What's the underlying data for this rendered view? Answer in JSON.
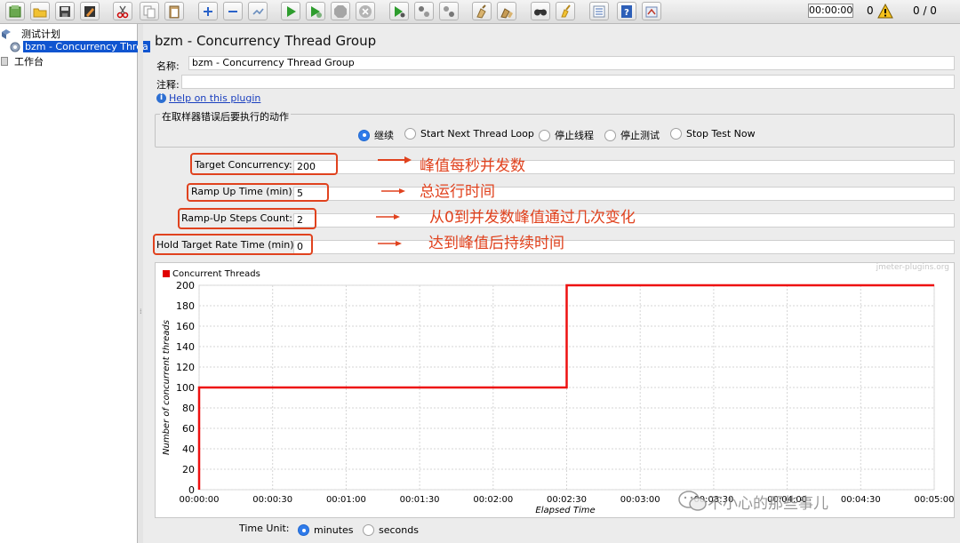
{
  "toolbar": {
    "timer": "00:00:00",
    "warning_count": "0",
    "threads": "0 / 0",
    "icons": [
      "templates-icon",
      "open-icon",
      "save-icon",
      "edit-icon",
      "cut-icon",
      "copy-icon",
      "paste-icon",
      "expand-icon",
      "collapse-icon",
      "toggle-icon",
      "start-icon",
      "start-no-pause-icon",
      "stop-icon",
      "shutdown-icon",
      "remote-start-icon",
      "remote-stop-icon",
      "remote-exit-icon",
      "clear-icon",
      "clear-all-icon",
      "search-icon",
      "reset-search-icon",
      "function-helper-icon",
      "help-icon",
      "options-icon"
    ]
  },
  "tree": {
    "root": "测试计划",
    "selected": "bzm - Concurrency Threa",
    "workbench": "工作台"
  },
  "panel": {
    "title": "bzm - Concurrency Thread Group",
    "name_label": "名称:",
    "name_value": "bzm - Concurrency Thread Group",
    "comment_label": "注释:",
    "comment_value": "",
    "help_link": "Help on this plugin",
    "error_group_title": "在取样器错误后要执行的动作",
    "error_options": [
      {
        "label": "继续",
        "selected": true
      },
      {
        "label": "Start Next Thread Loop",
        "selected": false
      },
      {
        "label": "停止线程",
        "selected": false
      },
      {
        "label": "停止测试",
        "selected": false
      },
      {
        "label": "Stop Test Now",
        "selected": false
      }
    ]
  },
  "params": [
    {
      "label": "Target Concurrency:",
      "value": "200",
      "annotation": "峰值每秒并发数"
    },
    {
      "label": "Ramp Up Time (min):",
      "value": "5",
      "annotation": "总运行时间"
    },
    {
      "label": "Ramp-Up Steps Count:",
      "value": "2",
      "annotation": "从0到并发数峰值通过几次变化"
    },
    {
      "label": "Hold Target Rate Time (min):",
      "value": "0",
      "annotation": "达到峰值后持续时间"
    }
  ],
  "chart_data": {
    "type": "line",
    "legend": "Concurrent Threads",
    "watermark": "jmeter-plugins.org",
    "ylabel": "Number of concurrent threads",
    "xlabel": "Elapsed Time",
    "x_ticks": [
      "00:00:00",
      "00:00:30",
      "00:01:00",
      "00:01:30",
      "00:02:00",
      "00:02:30",
      "00:03:00",
      "00:03:30",
      "00:04:00",
      "00:04:30",
      "00:05:00"
    ],
    "y_ticks": [
      "0",
      "20",
      "40",
      "60",
      "80",
      "100",
      "120",
      "140",
      "160",
      "180",
      "200"
    ],
    "ylim": [
      0,
      200
    ],
    "xlim_seconds": [
      0,
      300
    ],
    "series": [
      {
        "name": "Concurrent Threads",
        "color": "#ee1111",
        "points_seconds": [
          [
            0,
            0
          ],
          [
            0,
            100
          ],
          [
            150,
            100
          ],
          [
            150,
            200
          ],
          [
            300,
            200
          ]
        ]
      }
    ]
  },
  "time_unit": {
    "label": "Time Unit:",
    "options": [
      {
        "label": "minutes",
        "selected": true
      },
      {
        "label": "seconds",
        "selected": false
      }
    ]
  },
  "watermark_text": "不小心的那些事儿"
}
